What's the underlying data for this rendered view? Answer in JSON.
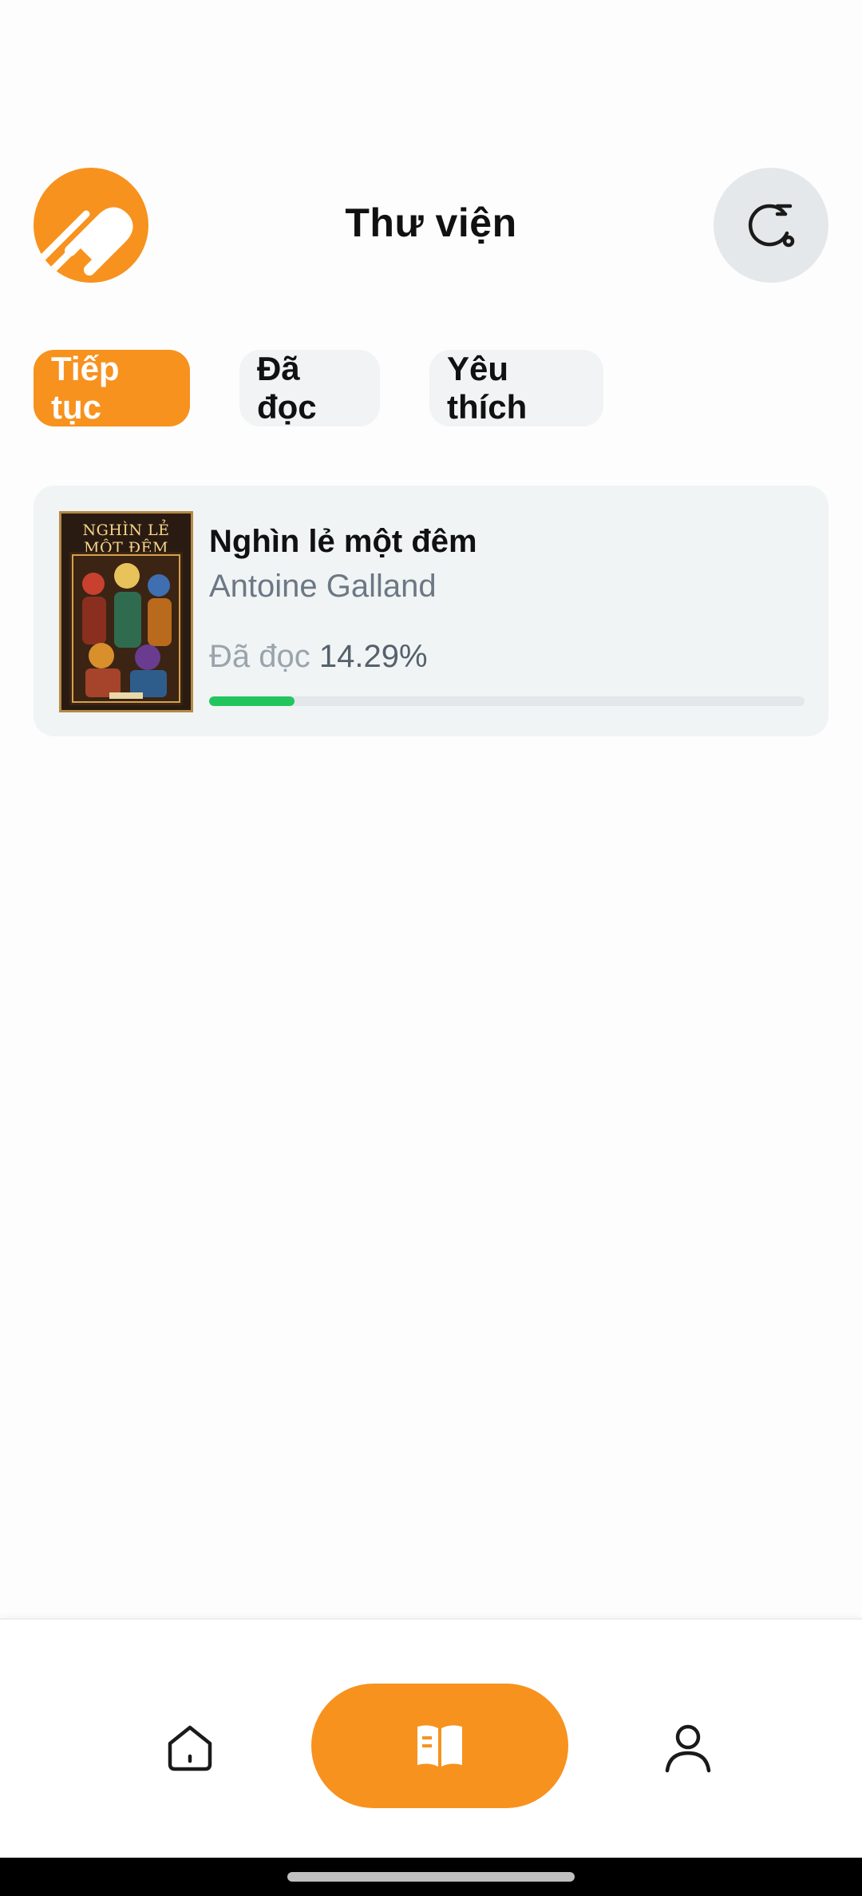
{
  "header": {
    "title": "Thư viện",
    "logo_icon": "app-logo-icon",
    "history_icon": "history-icon"
  },
  "tabs": [
    {
      "label": "Tiếp tục",
      "active": true
    },
    {
      "label": "Đã đọc",
      "active": false
    },
    {
      "label": "Yêu thích",
      "active": false
    }
  ],
  "books": [
    {
      "title": "Nghìn lẻ một đêm",
      "author": "Antoine Galland",
      "cover_title": "NGHÌN LẺ MỘT ĐÊM",
      "progress_label": "Đã đọc",
      "progress_value": "14.29%",
      "progress_fraction": 0.1429
    }
  ],
  "bottom_nav": [
    {
      "icon": "home-icon",
      "active": false
    },
    {
      "icon": "book-open-icon",
      "active": true
    },
    {
      "icon": "user-icon",
      "active": false
    }
  ],
  "colors": {
    "accent": "#f7921e",
    "progress": "#22c55e",
    "card_bg": "#f1f4f5",
    "muted_text": "#6c7884"
  }
}
